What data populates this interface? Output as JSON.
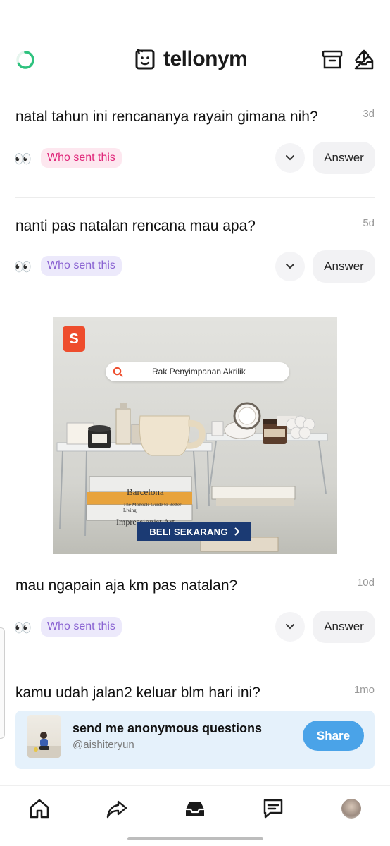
{
  "header": {
    "logo_text": "tellonym",
    "icons": {
      "left": "loading-spinner-icon",
      "archive": "archive-icon",
      "share": "share-inbox-icon"
    },
    "accent": "#2ec27e"
  },
  "questions": [
    {
      "text": "natal tahun ini rencananya rayain gimana nih?",
      "time": "3d",
      "who_label": "Who sent this",
      "who_style": "pink",
      "answer_label": "Answer"
    },
    {
      "text": "nanti pas natalan rencana mau apa?",
      "time": "5d",
      "who_label": "Who sent this",
      "who_style": "purple",
      "answer_label": "Answer"
    },
    {
      "text": "mau ngapain aja km pas natalan?",
      "time": "10d",
      "who_label": "Who sent this",
      "who_style": "purple",
      "answer_label": "Answer"
    },
    {
      "text": "kamu udah jalan2 keluar blm hari ini?",
      "time": "1mo"
    }
  ],
  "ad": {
    "brand_icon": "shopee-bag-icon",
    "search_text": "Rak Penyimpanan Akrilik",
    "cta_label": "BELI SEKARANG",
    "book_1": "Barcelona",
    "book_2": "The Monocle Guide to Better Living",
    "book_3": "Impressionist Art"
  },
  "banner": {
    "title": "send me anonymous questions",
    "handle": "@aishiteryun",
    "share_label": "Share",
    "colors": {
      "background": "#e5f1fb",
      "button": "#4aa3e8"
    }
  },
  "nav": {
    "items": [
      "home-icon",
      "forward-arrow-icon",
      "inbox-tray-icon",
      "chat-icon",
      "profile-avatar"
    ]
  }
}
